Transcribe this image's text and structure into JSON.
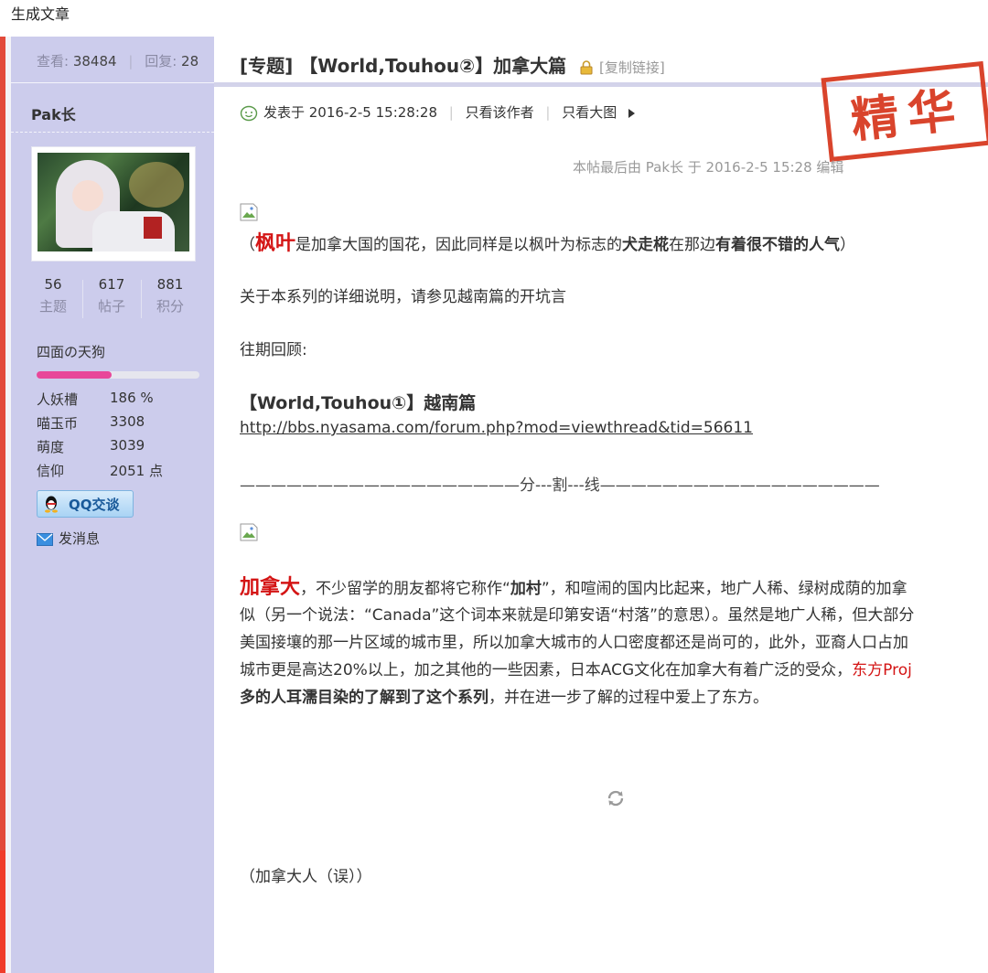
{
  "window": {
    "title": "生成文章"
  },
  "sidebar": {
    "views_label": "查看:",
    "views": "38484",
    "replies_label": "回复:",
    "replies": "28",
    "username": "Pak长",
    "counts": [
      {
        "value": "56",
        "label": "主题"
      },
      {
        "value": "617",
        "label": "帖子"
      },
      {
        "value": "881",
        "label": "积分"
      }
    ],
    "rank": "四面の天狗",
    "rank_progress": 0.46,
    "attributes": [
      {
        "key": "人妖槽",
        "value": "186 %"
      },
      {
        "key": "喵玉币",
        "value": "3308"
      },
      {
        "key": "萌度",
        "value": "3039"
      },
      {
        "key": "信仰",
        "value": "2051 点"
      }
    ],
    "qq_button": "QQ交谈",
    "message_link": "发消息"
  },
  "post": {
    "title": "[专题] 【World,Touhou②】加拿大篇",
    "copy_link": "[复制链接]",
    "posted_at": "发表于 2016-2-5 15:28:28",
    "only_author": "只看该作者",
    "only_big_images": "只看大图",
    "edit_note": "本帖最后由 Pak长 于 2016-2-5 15:28 编辑",
    "stamp": "精华",
    "para1": {
      "open": "（",
      "red": "枫叶",
      "t1": "是加拿大国的国花，因此同样是以枫叶为标志的",
      "b1": "犬走椛",
      "t2": "在那边",
      "b2": "有着很不错的人气",
      "close": "）"
    },
    "intro": "关于本系列的详细说明，请参见越南篇的开坑言",
    "past_label": "往期回顾:",
    "past_title": "【World,Touhou①】越南篇",
    "past_link": "http://bbs.nyasama.com/forum.php?mod=viewthread&tid=56611",
    "divider": "——————————————————分---割---线——————————————————",
    "body": {
      "l1_red": "加拿大",
      "l1_a": "，不少留学的朋友都将它称作“",
      "l1_b": "加村",
      "l1_c": "”，和喧闹的国内比起来，地广人稀、绿树成荫的加拿",
      "l2": "似（另一个说法：“Canada”这个词本来就是印第安语“村落”的意思）。虽然是地广人稀，但大部分",
      "l3": "美国接壤的那一片区域的城市里，所以加拿大城市的人口密度都还是尚可的，此外，亚裔人口占加",
      "l4_a": "城市更是高达20%以上，加之其他的一些因素，日本ACG文化在加拿大有着广泛的受众，",
      "l4_red": "东方Proj",
      "l5_b": "多的人耳濡目染的了解到了这个系列",
      "l5_a": "，并在进一步了解的过程中爱上了东方。"
    },
    "caption": "（加拿大人（误））"
  },
  "colors": {
    "sidebar_bg": "#ccccec",
    "accent_red": "#d41515",
    "stamp_red": "#d9442c",
    "progress_pink": "#e8479a"
  }
}
